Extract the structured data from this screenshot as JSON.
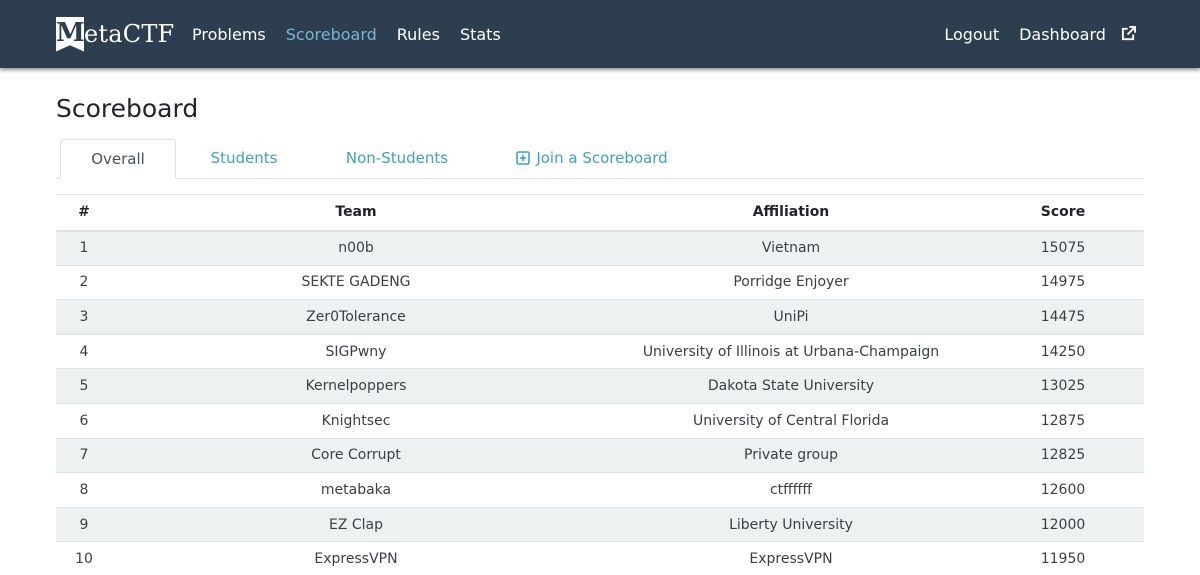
{
  "brand": {
    "logo_letter": "M",
    "name_rest": "etaCTF"
  },
  "nav": {
    "left": [
      {
        "label": "Problems",
        "active": false
      },
      {
        "label": "Scoreboard",
        "active": true
      },
      {
        "label": "Rules",
        "active": false
      },
      {
        "label": "Stats",
        "active": false
      }
    ],
    "logout": "Logout",
    "dashboard": "Dashboard",
    "dashboard_icon": "external-link-icon"
  },
  "page_title": "Scoreboard",
  "tabs": [
    {
      "label": "Overall",
      "active": true
    },
    {
      "label": "Students",
      "active": false
    },
    {
      "label": "Non-Students",
      "active": false
    },
    {
      "label": "Join a Scoreboard",
      "active": false,
      "icon": "plus-square-icon"
    }
  ],
  "table": {
    "headers": {
      "rank": "#",
      "team": "Team",
      "affiliation": "Affiliation",
      "score": "Score"
    },
    "rows": [
      {
        "rank": "1",
        "team": "n00b",
        "affiliation": "Vietnam",
        "score": "15075"
      },
      {
        "rank": "2",
        "team": "SEKTE GADENG",
        "affiliation": "Porridge Enjoyer",
        "score": "14975"
      },
      {
        "rank": "3",
        "team": "Zer0Tolerance",
        "affiliation": "UniPi",
        "score": "14475"
      },
      {
        "rank": "4",
        "team": "SIGPwny",
        "affiliation": "University of Illinois at Urbana-Champaign",
        "score": "14250"
      },
      {
        "rank": "5",
        "team": "Kernelpoppers",
        "affiliation": "Dakota State University",
        "score": "13025"
      },
      {
        "rank": "6",
        "team": "Knightsec",
        "affiliation": "University of Central Florida",
        "score": "12875"
      },
      {
        "rank": "7",
        "team": "Core Corrupt",
        "affiliation": "Private group",
        "score": "12825"
      },
      {
        "rank": "8",
        "team": "metabaka",
        "affiliation": "ctffffff",
        "score": "12600"
      },
      {
        "rank": "9",
        "team": "EZ Clap",
        "affiliation": "Liberty University",
        "score": "12000"
      },
      {
        "rank": "10",
        "team": "ExpressVPN",
        "affiliation": "ExpressVPN",
        "score": "11950"
      }
    ]
  },
  "colors": {
    "navbar": "#2d3e50",
    "active_nav": "#78b4d3",
    "link": "#3f9fc6",
    "stripe": "#eef1f2"
  }
}
